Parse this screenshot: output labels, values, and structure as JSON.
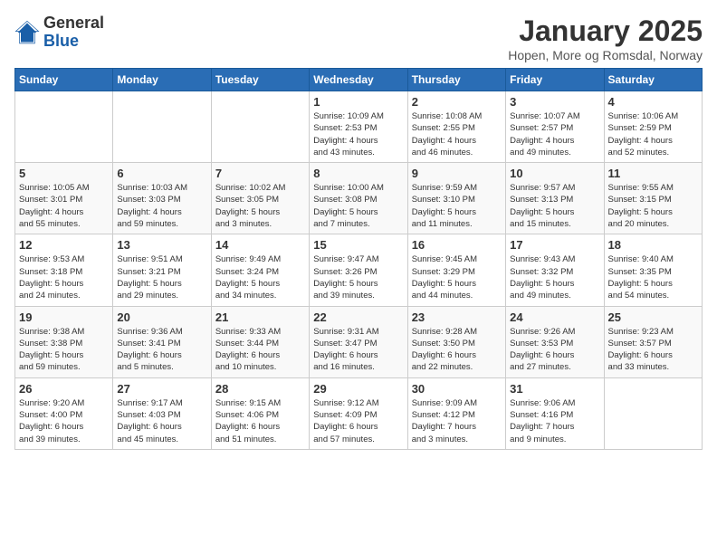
{
  "logo": {
    "general": "General",
    "blue": "Blue"
  },
  "title": "January 2025",
  "subtitle": "Hopen, More og Romsdal, Norway",
  "days_of_week": [
    "Sunday",
    "Monday",
    "Tuesday",
    "Wednesday",
    "Thursday",
    "Friday",
    "Saturday"
  ],
  "weeks": [
    [
      {
        "day": "",
        "info": ""
      },
      {
        "day": "",
        "info": ""
      },
      {
        "day": "",
        "info": ""
      },
      {
        "day": "1",
        "info": "Sunrise: 10:09 AM\nSunset: 2:53 PM\nDaylight: 4 hours\nand 43 minutes."
      },
      {
        "day": "2",
        "info": "Sunrise: 10:08 AM\nSunset: 2:55 PM\nDaylight: 4 hours\nand 46 minutes."
      },
      {
        "day": "3",
        "info": "Sunrise: 10:07 AM\nSunset: 2:57 PM\nDaylight: 4 hours\nand 49 minutes."
      },
      {
        "day": "4",
        "info": "Sunrise: 10:06 AM\nSunset: 2:59 PM\nDaylight: 4 hours\nand 52 minutes."
      }
    ],
    [
      {
        "day": "5",
        "info": "Sunrise: 10:05 AM\nSunset: 3:01 PM\nDaylight: 4 hours\nand 55 minutes."
      },
      {
        "day": "6",
        "info": "Sunrise: 10:03 AM\nSunset: 3:03 PM\nDaylight: 4 hours\nand 59 minutes."
      },
      {
        "day": "7",
        "info": "Sunrise: 10:02 AM\nSunset: 3:05 PM\nDaylight: 5 hours\nand 3 minutes."
      },
      {
        "day": "8",
        "info": "Sunrise: 10:00 AM\nSunset: 3:08 PM\nDaylight: 5 hours\nand 7 minutes."
      },
      {
        "day": "9",
        "info": "Sunrise: 9:59 AM\nSunset: 3:10 PM\nDaylight: 5 hours\nand 11 minutes."
      },
      {
        "day": "10",
        "info": "Sunrise: 9:57 AM\nSunset: 3:13 PM\nDaylight: 5 hours\nand 15 minutes."
      },
      {
        "day": "11",
        "info": "Sunrise: 9:55 AM\nSunset: 3:15 PM\nDaylight: 5 hours\nand 20 minutes."
      }
    ],
    [
      {
        "day": "12",
        "info": "Sunrise: 9:53 AM\nSunset: 3:18 PM\nDaylight: 5 hours\nand 24 minutes."
      },
      {
        "day": "13",
        "info": "Sunrise: 9:51 AM\nSunset: 3:21 PM\nDaylight: 5 hours\nand 29 minutes."
      },
      {
        "day": "14",
        "info": "Sunrise: 9:49 AM\nSunset: 3:24 PM\nDaylight: 5 hours\nand 34 minutes."
      },
      {
        "day": "15",
        "info": "Sunrise: 9:47 AM\nSunset: 3:26 PM\nDaylight: 5 hours\nand 39 minutes."
      },
      {
        "day": "16",
        "info": "Sunrise: 9:45 AM\nSunset: 3:29 PM\nDaylight: 5 hours\nand 44 minutes."
      },
      {
        "day": "17",
        "info": "Sunrise: 9:43 AM\nSunset: 3:32 PM\nDaylight: 5 hours\nand 49 minutes."
      },
      {
        "day": "18",
        "info": "Sunrise: 9:40 AM\nSunset: 3:35 PM\nDaylight: 5 hours\nand 54 minutes."
      }
    ],
    [
      {
        "day": "19",
        "info": "Sunrise: 9:38 AM\nSunset: 3:38 PM\nDaylight: 5 hours\nand 59 minutes."
      },
      {
        "day": "20",
        "info": "Sunrise: 9:36 AM\nSunset: 3:41 PM\nDaylight: 6 hours\nand 5 minutes."
      },
      {
        "day": "21",
        "info": "Sunrise: 9:33 AM\nSunset: 3:44 PM\nDaylight: 6 hours\nand 10 minutes."
      },
      {
        "day": "22",
        "info": "Sunrise: 9:31 AM\nSunset: 3:47 PM\nDaylight: 6 hours\nand 16 minutes."
      },
      {
        "day": "23",
        "info": "Sunrise: 9:28 AM\nSunset: 3:50 PM\nDaylight: 6 hours\nand 22 minutes."
      },
      {
        "day": "24",
        "info": "Sunrise: 9:26 AM\nSunset: 3:53 PM\nDaylight: 6 hours\nand 27 minutes."
      },
      {
        "day": "25",
        "info": "Sunrise: 9:23 AM\nSunset: 3:57 PM\nDaylight: 6 hours\nand 33 minutes."
      }
    ],
    [
      {
        "day": "26",
        "info": "Sunrise: 9:20 AM\nSunset: 4:00 PM\nDaylight: 6 hours\nand 39 minutes."
      },
      {
        "day": "27",
        "info": "Sunrise: 9:17 AM\nSunset: 4:03 PM\nDaylight: 6 hours\nand 45 minutes."
      },
      {
        "day": "28",
        "info": "Sunrise: 9:15 AM\nSunset: 4:06 PM\nDaylight: 6 hours\nand 51 minutes."
      },
      {
        "day": "29",
        "info": "Sunrise: 9:12 AM\nSunset: 4:09 PM\nDaylight: 6 hours\nand 57 minutes."
      },
      {
        "day": "30",
        "info": "Sunrise: 9:09 AM\nSunset: 4:12 PM\nDaylight: 7 hours\nand 3 minutes."
      },
      {
        "day": "31",
        "info": "Sunrise: 9:06 AM\nSunset: 4:16 PM\nDaylight: 7 hours\nand 9 minutes."
      },
      {
        "day": "",
        "info": ""
      }
    ]
  ]
}
